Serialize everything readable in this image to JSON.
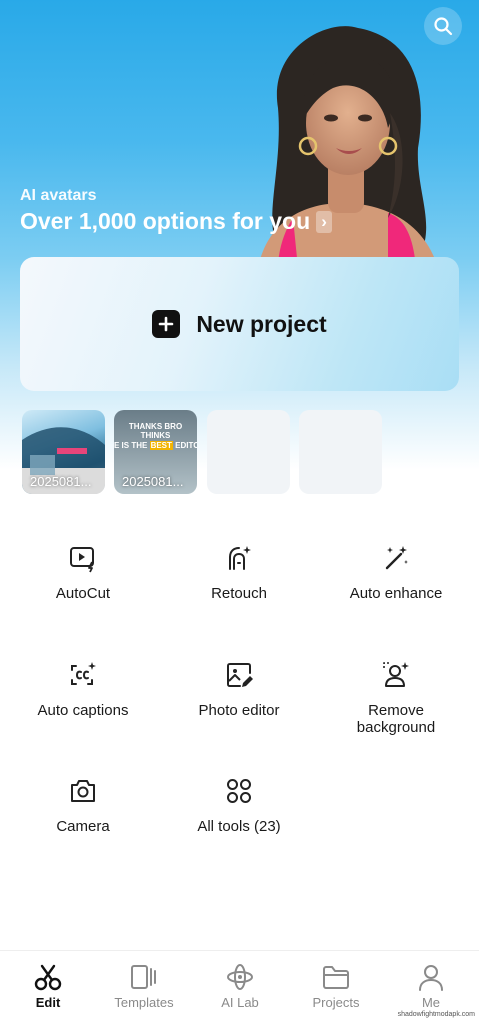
{
  "hero": {
    "kicker": "AI avatars",
    "title": "Over 1,000 options for you",
    "chevron": "›"
  },
  "search": {
    "icon": "search-icon"
  },
  "new_project": {
    "label": "New project",
    "icon": "plus-icon"
  },
  "recent": [
    {
      "date": "2025081..."
    },
    {
      "date": "2025081...",
      "caption_top": "THANKS BRO THINKS",
      "caption_pre": "E IS THE ",
      "caption_highlight": "BEST",
      "caption_post": " EDITO"
    }
  ],
  "tools": [
    {
      "label": "AutoCut",
      "icon": "autocut-icon"
    },
    {
      "label": "Retouch",
      "icon": "retouch-icon"
    },
    {
      "label": "Auto enhance",
      "icon": "magic-wand-icon"
    },
    {
      "label": "Auto captions",
      "icon": "captions-icon"
    },
    {
      "label": "Photo editor",
      "icon": "photo-edit-icon"
    },
    {
      "label": "Remove\nbackground",
      "icon": "remove-background-icon"
    },
    {
      "label": "Camera",
      "icon": "camera-icon"
    },
    {
      "label": "All tools (23)",
      "icon": "grid-icon"
    }
  ],
  "nav": [
    {
      "label": "Edit",
      "icon": "scissors-icon",
      "active": true
    },
    {
      "label": "Templates",
      "icon": "templates-icon",
      "active": false
    },
    {
      "label": "AI Lab",
      "icon": "ai-lab-icon",
      "active": false
    },
    {
      "label": "Projects",
      "icon": "folder-icon",
      "active": false
    },
    {
      "label": "Me",
      "icon": "person-icon",
      "active": false
    }
  ],
  "watermark": "shadowfightmodapk.com",
  "colors": {
    "hero_top": "#29a9e8",
    "accent_dark": "#111111",
    "inactive": "#8a8a8a"
  }
}
